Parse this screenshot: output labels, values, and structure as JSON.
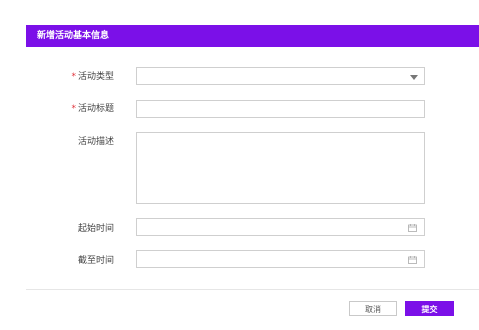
{
  "form": {
    "title": "新增活动基本信息",
    "required_mark": "*",
    "activity_type": {
      "label": "活动类型",
      "value": "",
      "placeholder": ""
    },
    "activity_title": {
      "label": "活动标题",
      "value": "",
      "placeholder": ""
    },
    "activity_desc": {
      "label": "活动描述",
      "value": "",
      "placeholder": ""
    },
    "start_time": {
      "label": "起始时间",
      "value": "",
      "placeholder": ""
    },
    "end_time": {
      "label": "截至时间",
      "value": "",
      "placeholder": ""
    }
  },
  "actions": {
    "cancel_label": "取消",
    "submit_label": "提交"
  },
  "colors": {
    "accent": "#7b10e8",
    "required": "#e0323b",
    "border": "#cfcfcf"
  },
  "icons": {
    "dropdown": "chevron-down-icon",
    "date": "calendar-icon"
  }
}
